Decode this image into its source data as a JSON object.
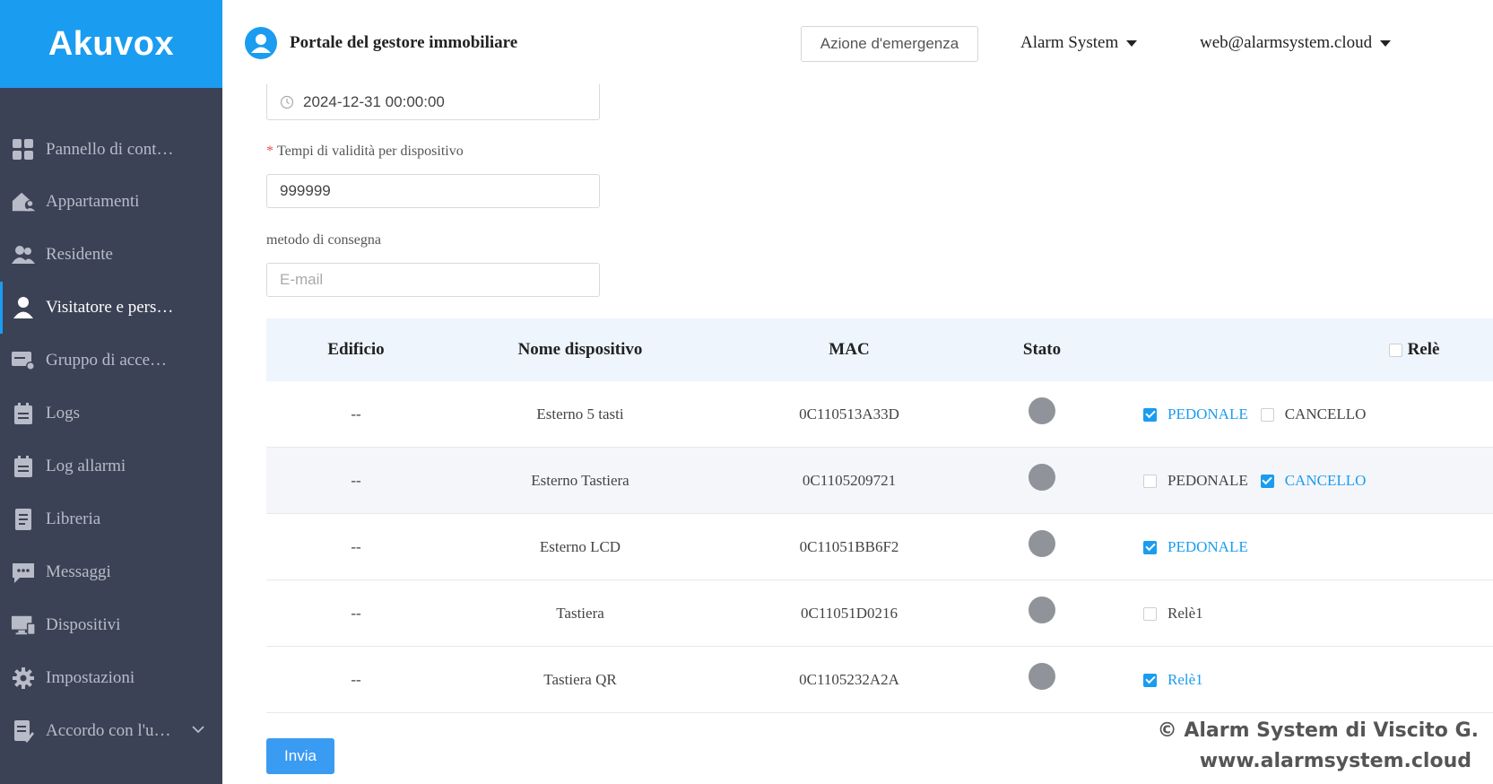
{
  "brand": {
    "logo": "Akuvox"
  },
  "sidebar": {
    "items": [
      {
        "label": "Pannello di cont…",
        "icon": "dashboard-icon"
      },
      {
        "label": "Appartamenti",
        "icon": "apartment-icon"
      },
      {
        "label": "Residente",
        "icon": "residents-icon"
      },
      {
        "label": "Visitatore e pers…",
        "icon": "visitor-icon",
        "active": true
      },
      {
        "label": "Gruppo di acce…",
        "icon": "access-group-icon"
      },
      {
        "label": "Logs",
        "icon": "logs-icon"
      },
      {
        "label": "Log allarmi",
        "icon": "alarm-logs-icon"
      },
      {
        "label": "Libreria",
        "icon": "library-icon"
      },
      {
        "label": "Messaggi",
        "icon": "messages-icon"
      },
      {
        "label": "Dispositivi",
        "icon": "devices-icon"
      },
      {
        "label": "Impostazioni",
        "icon": "settings-icon"
      },
      {
        "label": "Accordo con l'u…",
        "icon": "agreement-icon"
      }
    ]
  },
  "header": {
    "title": "Portale del gestore immobiliare",
    "emergency_button": "Azione d'emergenza",
    "company": "Alarm System",
    "user": "web@alarmsystem.cloud"
  },
  "form": {
    "end_time": "2024-12-31 00:00:00",
    "validity_label": "Tempi di validità per dispositivo",
    "validity_value": "999999",
    "delivery_label": "metodo di consegna",
    "delivery_placeholder": "E-mail"
  },
  "table": {
    "headers": {
      "building": "Edificio",
      "device": "Nome dispositivo",
      "mac": "MAC",
      "status": "Stato",
      "relay": "Relè"
    },
    "rows": [
      {
        "building": "--",
        "device": "Esterno 5 tasti",
        "mac": "0C110513A33D",
        "relays": [
          {
            "label": "PEDONALE",
            "checked": true
          },
          {
            "label": "CANCELLO",
            "checked": false
          }
        ]
      },
      {
        "building": "--",
        "device": "Esterno Tastiera",
        "mac": "0C1105209721",
        "relays": [
          {
            "label": "PEDONALE",
            "checked": false
          },
          {
            "label": "CANCELLO",
            "checked": true
          }
        ]
      },
      {
        "building": "--",
        "device": "Esterno LCD",
        "mac": "0C11051BB6F2",
        "relays": [
          {
            "label": "PEDONALE",
            "checked": true
          }
        ]
      },
      {
        "building": "--",
        "device": "Tastiera",
        "mac": "0C11051D0216",
        "relays": [
          {
            "label": "Relè1",
            "checked": false
          }
        ]
      },
      {
        "building": "--",
        "device": "Tastiera QR",
        "mac": "0C1105232A2A",
        "relays": [
          {
            "label": "Relè1",
            "checked": true
          }
        ]
      }
    ]
  },
  "actions": {
    "submit": "Invia"
  },
  "watermark": {
    "line1": "© Alarm System di Viscito G.",
    "line2": "www.alarmsystem.cloud"
  },
  "colors": {
    "accent": "#1a9cf0",
    "sidebar_bg": "#3c4256",
    "status_offline": "#909399"
  }
}
